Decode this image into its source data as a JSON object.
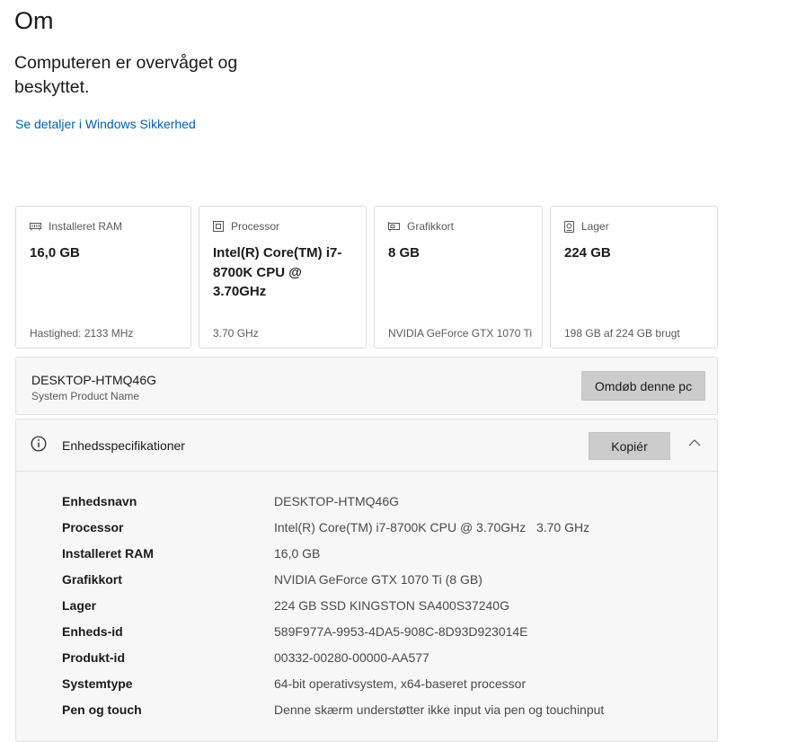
{
  "page": {
    "title": "Om",
    "status": "Computeren er overvåget og beskyttet.",
    "security_link": "Se detaljer i Windows Sikkerhed"
  },
  "cards": [
    {
      "icon": "ram-icon",
      "label": "Installeret RAM",
      "value": "16,0 GB",
      "footer": "Hastighed: 2133 MHz"
    },
    {
      "icon": "processor-icon",
      "label": "Processor",
      "value": "Intel(R) Core(TM) i7-8700K CPU @ 3.70GHz",
      "footer": "3.70 GHz"
    },
    {
      "icon": "graphics-card-icon",
      "label": "Grafikkort",
      "value": "8 GB",
      "footer": "NVIDIA GeForce GTX 1070 Ti"
    },
    {
      "icon": "storage-icon",
      "label": "Lager",
      "value": "224 GB",
      "footer": "198 GB af 224 GB brugt"
    }
  ],
  "device": {
    "name": "DESKTOP-HTMQ46G",
    "subtitle": "System Product Name",
    "rename_label": "Omdøb denne pc"
  },
  "specs": {
    "title": "Enhedsspecifikationer",
    "copy_label": "Kopiér",
    "rows": [
      {
        "label": "Enhedsnavn",
        "value": "DESKTOP-HTMQ46G"
      },
      {
        "label": "Processor",
        "value": "Intel(R) Core(TM) i7-8700K CPU @ 3.70GHz   3.70 GHz"
      },
      {
        "label": "Installeret RAM",
        "value": "16,0 GB"
      },
      {
        "label": "Grafikkort",
        "value": "NVIDIA GeForce GTX 1070 Ti (8 GB)"
      },
      {
        "label": "Lager",
        "value": "224 GB SSD KINGSTON SA400S37240G"
      },
      {
        "label": "Enheds-id",
        "value": "589F977A-9953-4DA5-908C-8D93D923014E"
      },
      {
        "label": "Produkt-id",
        "value": "00332-00280-00000-AA577"
      },
      {
        "label": "Systemtype",
        "value": "64-bit operativsystem, x64-baseret processor"
      },
      {
        "label": "Pen og touch",
        "value": "Denne skærm understøtter ikke input via pen og touchinput"
      }
    ]
  },
  "colors": {
    "accent_link": "#005fb8",
    "button_bg": "#cccccc",
    "panel_bg": "#f7f7f7"
  }
}
